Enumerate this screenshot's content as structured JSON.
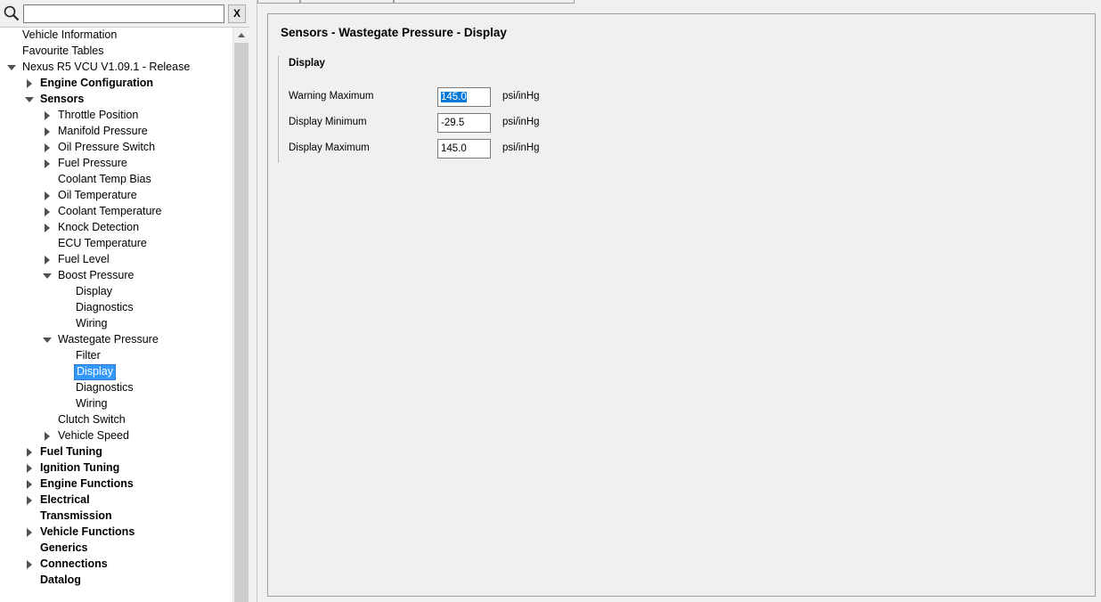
{
  "search": {
    "value": "",
    "clear_label": "X"
  },
  "tree": {
    "items": [
      {
        "label": "Vehicle Information",
        "bold": false,
        "arrow": "none"
      },
      {
        "label": "Favourite Tables",
        "bold": false,
        "arrow": "none"
      },
      {
        "label": "Nexus R5 VCU V1.09.1 - Release",
        "bold": false,
        "arrow": "down"
      },
      {
        "label": "Engine Configuration",
        "bold": true,
        "arrow": "right"
      },
      {
        "label": "Sensors",
        "bold": true,
        "arrow": "down"
      },
      {
        "label": "Throttle Position",
        "bold": false,
        "arrow": "right"
      },
      {
        "label": "Manifold Pressure",
        "bold": false,
        "arrow": "right"
      },
      {
        "label": "Oil Pressure Switch",
        "bold": false,
        "arrow": "right"
      },
      {
        "label": "Fuel Pressure",
        "bold": false,
        "arrow": "right"
      },
      {
        "label": "Coolant Temp Bias",
        "bold": false,
        "arrow": "none"
      },
      {
        "label": "Oil Temperature",
        "bold": false,
        "arrow": "right"
      },
      {
        "label": "Coolant Temperature",
        "bold": false,
        "arrow": "right"
      },
      {
        "label": "Knock Detection",
        "bold": false,
        "arrow": "right"
      },
      {
        "label": "ECU Temperature",
        "bold": false,
        "arrow": "none"
      },
      {
        "label": "Fuel Level",
        "bold": false,
        "arrow": "right"
      },
      {
        "label": "Boost Pressure",
        "bold": false,
        "arrow": "down"
      },
      {
        "label": "Display",
        "bold": false,
        "arrow": "none"
      },
      {
        "label": "Diagnostics",
        "bold": false,
        "arrow": "none"
      },
      {
        "label": "Wiring",
        "bold": false,
        "arrow": "none"
      },
      {
        "label": "Wastegate Pressure",
        "bold": false,
        "arrow": "down"
      },
      {
        "label": "Filter",
        "bold": false,
        "arrow": "none"
      },
      {
        "label": "Display",
        "bold": false,
        "arrow": "none",
        "selected": true
      },
      {
        "label": "Diagnostics",
        "bold": false,
        "arrow": "none"
      },
      {
        "label": "Wiring",
        "bold": false,
        "arrow": "none"
      },
      {
        "label": "Clutch Switch",
        "bold": false,
        "arrow": "none"
      },
      {
        "label": "Vehicle Speed",
        "bold": false,
        "arrow": "right"
      },
      {
        "label": "Fuel Tuning",
        "bold": true,
        "arrow": "right"
      },
      {
        "label": "Ignition Tuning",
        "bold": true,
        "arrow": "right"
      },
      {
        "label": "Engine Functions",
        "bold": true,
        "arrow": "right"
      },
      {
        "label": "Electrical",
        "bold": true,
        "arrow": "right"
      },
      {
        "label": "Transmission",
        "bold": true,
        "arrow": "none"
      },
      {
        "label": "Vehicle Functions",
        "bold": true,
        "arrow": "right"
      },
      {
        "label": "Generics",
        "bold": true,
        "arrow": "none"
      },
      {
        "label": "Connections",
        "bold": true,
        "arrow": "right"
      },
      {
        "label": "Datalog",
        "bold": true,
        "arrow": "none"
      }
    ]
  },
  "content": {
    "title": "Sensors - Wastegate Pressure - Display",
    "group_title": "Display",
    "fields": [
      {
        "label": "Warning Maximum",
        "value": "145.0",
        "unit": "psi/inHg",
        "selected": true
      },
      {
        "label": "Display Minimum",
        "value": "-29.5",
        "unit": "psi/inHg",
        "selected": false
      },
      {
        "label": "Display Maximum",
        "value": "145.0",
        "unit": "psi/inHg",
        "selected": false
      }
    ]
  }
}
